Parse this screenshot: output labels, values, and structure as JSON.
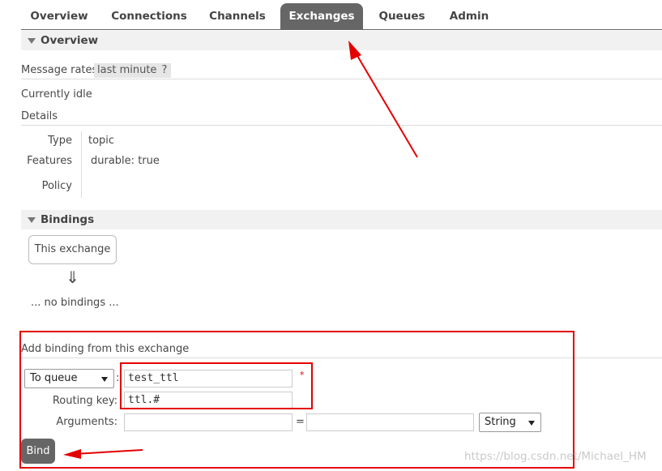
{
  "tabs": [
    {
      "label": "Overview"
    },
    {
      "label": "Connections"
    },
    {
      "label": "Channels"
    },
    {
      "label": "Exchanges",
      "active": true
    },
    {
      "label": "Queues"
    },
    {
      "label": "Admin"
    }
  ],
  "overview": {
    "title": "Overview",
    "message_rates_label": "Message rates",
    "message_rates_period": "last minute",
    "help": "?",
    "status": "Currently idle",
    "details_label": "Details",
    "type_label": "Type",
    "type_value": "topic",
    "features_label": "Features",
    "features_key": "durable:",
    "features_value": "true",
    "policy_label": "Policy"
  },
  "bindings": {
    "title": "Bindings",
    "this_exchange": "This exchange",
    "arrow": "⇓",
    "no_bindings": "... no bindings ..."
  },
  "add_binding": {
    "title": "Add binding from this exchange",
    "destination_type": "To queue",
    "colon": ":",
    "destination_value": "test_ttl",
    "required_mark": "*",
    "routing_key_label": "Routing key:",
    "routing_key_value": "ttl.#",
    "arguments_label": "Arguments:",
    "arguments_key": "",
    "equals": "=",
    "arguments_value": "",
    "arguments_type": "String",
    "bind_label": "Bind"
  },
  "watermark": "https://blog.csdn.net/Michael_HM",
  "colors": {
    "tab_active_bg": "#666666",
    "section_bg": "#f1f1f1",
    "annotation": "#e30000"
  }
}
